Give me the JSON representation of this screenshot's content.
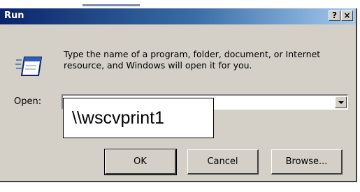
{
  "dialog": {
    "title": "Run",
    "help_label": "?",
    "close_label": "×",
    "description": "Type the name of a program, folder, document, or Internet resource, and Windows will open it for you.",
    "open_label": "Open:",
    "open_value": "\\\\wscvprint1",
    "icon": "run-window-icon",
    "buttons": {
      "ok": "OK",
      "cancel": "Cancel",
      "browse": "Browse..."
    }
  },
  "colors": {
    "titlebar_start": "#0a246a",
    "titlebar_end": "#a6caf0",
    "face": "#d4d0c8"
  }
}
